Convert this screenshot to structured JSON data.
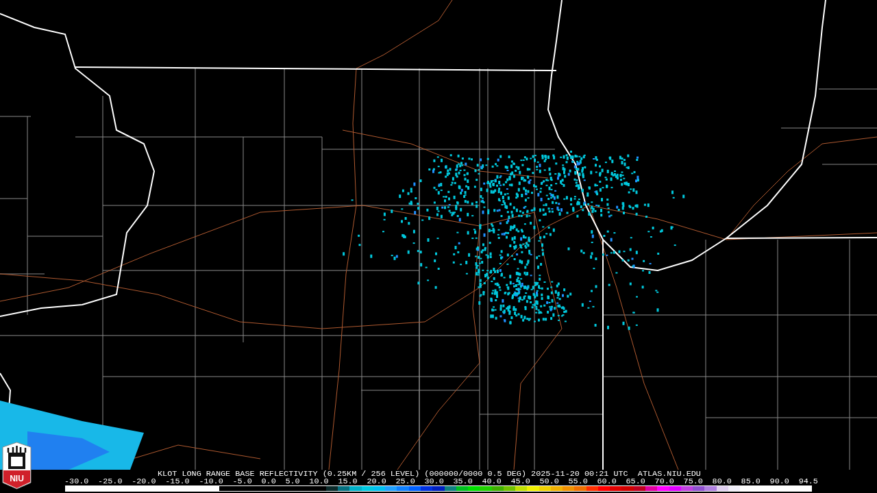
{
  "logo": {
    "text": "NIU"
  },
  "title": "KLOT LONG RANGE BASE REFLECTIVITY (0.25KM / 256 LEVEL) (000000/0000 0.5 DEG) 2025-11-20 00:21 UTC  ATLAS.NIU.EDU",
  "legend": {
    "labels": [
      "-30.0",
      "-25.0",
      "-20.0",
      "-15.0",
      "-10.0",
      "-5.0",
      "0.0",
      "5.0",
      "10.0",
      "15.0",
      "20.0",
      "25.0",
      "30.0",
      "35.0",
      "40.0",
      "45.0",
      "50.0",
      "55.0",
      "60.0",
      "65.0",
      "70.0",
      "75.0",
      "80.0",
      "85.0",
      "90.0",
      "94.5"
    ]
  }
}
